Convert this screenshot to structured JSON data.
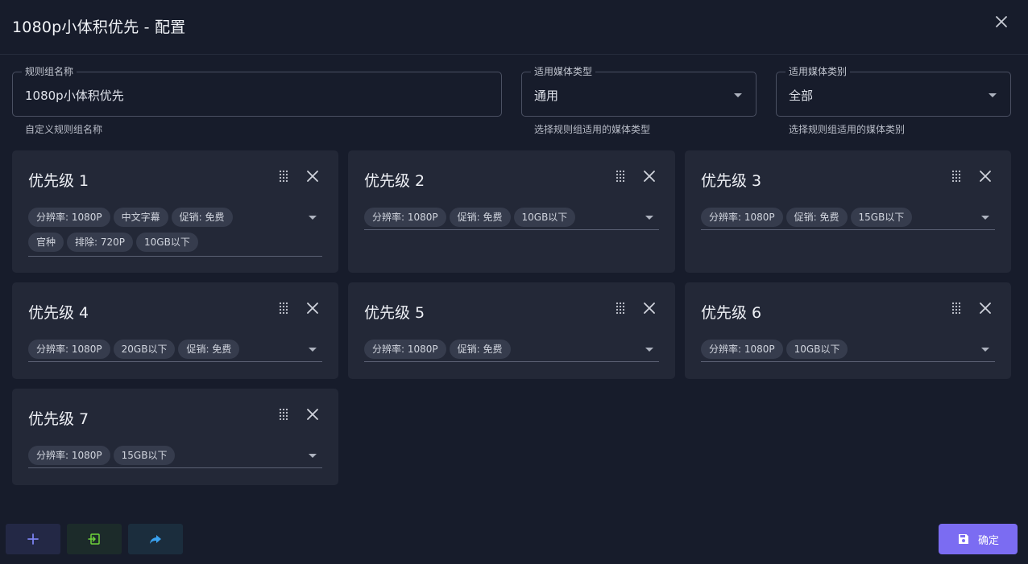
{
  "dialog": {
    "title": "1080p小体积优先 - 配置"
  },
  "fields": {
    "name": {
      "label": "规则组名称",
      "value": "1080p小体积优先",
      "hint": "自定义规则组名称"
    },
    "media_type": {
      "label": "适用媒体类型",
      "value": "通用",
      "hint": "选择规则组适用的媒体类型"
    },
    "media_category": {
      "label": "适用媒体类别",
      "value": "全部",
      "hint": "选择规则组适用的媒体类别"
    }
  },
  "priorities": [
    {
      "title": "优先级 1",
      "rules": [
        "分辨率: 1080P",
        "中文字幕",
        "促销: 免费",
        "官种",
        "排除: 720P",
        "10GB以下"
      ]
    },
    {
      "title": "优先级 2",
      "rules": [
        "分辨率: 1080P",
        "促销: 免费",
        "10GB以下"
      ]
    },
    {
      "title": "优先级 3",
      "rules": [
        "分辨率: 1080P",
        "促销: 免费",
        "15GB以下"
      ]
    },
    {
      "title": "优先级 4",
      "rules": [
        "分辨率: 1080P",
        "20GB以下",
        "促销: 免费"
      ]
    },
    {
      "title": "优先级 5",
      "rules": [
        "分辨率: 1080P",
        "促销: 免费"
      ]
    },
    {
      "title": "优先级 6",
      "rules": [
        "分辨率: 1080P",
        "10GB以下"
      ]
    },
    {
      "title": "优先级 7",
      "rules": [
        "分辨率: 1080P",
        "15GB以下"
      ]
    }
  ],
  "footer": {
    "confirm_label": "确定",
    "icons": [
      "plus-icon",
      "import-icon",
      "share-icon",
      "save-icon"
    ]
  },
  "colors": {
    "background": "#171c2b",
    "card": "#232837",
    "chip": "#363c4d",
    "accent": "#7b6cf2",
    "add_button": "#232845",
    "import_button": "#1c2b2a",
    "share_button": "#1b2d3d"
  }
}
